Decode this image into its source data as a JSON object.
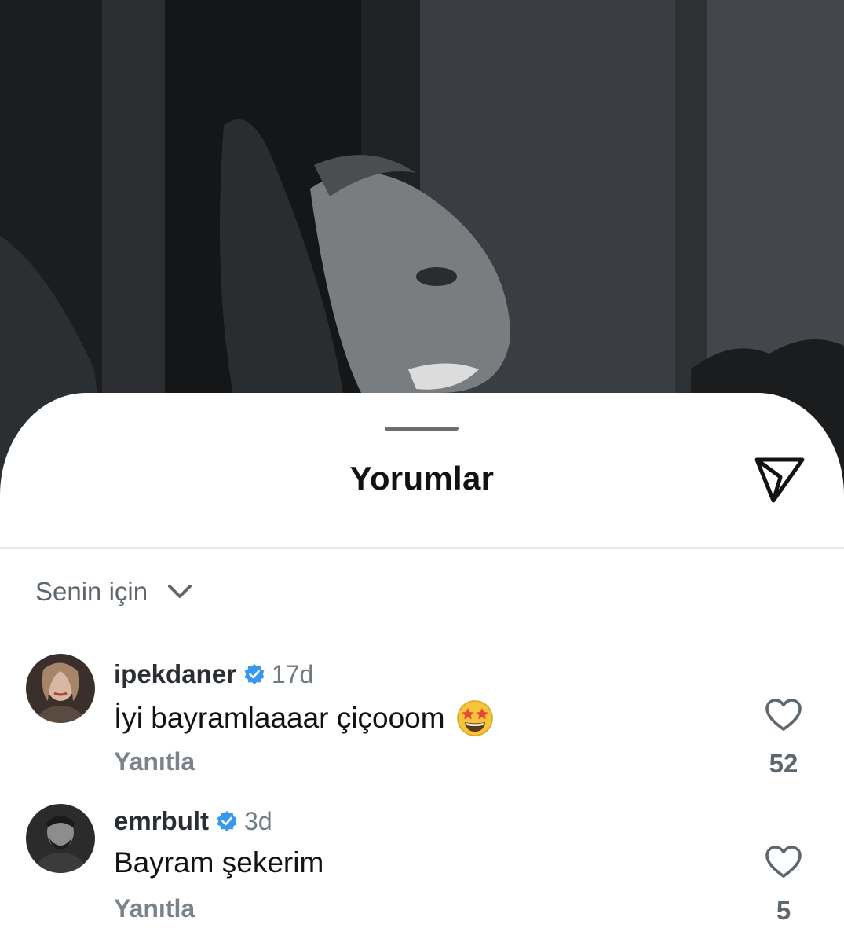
{
  "sheet": {
    "title": "Yorumlar",
    "share_icon": "send-paper-plane-icon",
    "sort_label": "Senin için",
    "sort_icon": "chevron-down-icon"
  },
  "comments": [
    {
      "username": "ipekdaner",
      "verified": true,
      "time": "17d",
      "text": "İyi bayramlaaaar çiçooom",
      "emoji": "star-struck-emoji",
      "reply_label": "Yanıtla",
      "likes": "52"
    },
    {
      "username": "emrbult",
      "verified": true,
      "time": "3d",
      "text": "Bayram şekerim",
      "reply_label": "Yanıtla",
      "likes": "5"
    }
  ],
  "colors": {
    "verified_badge": "#3897f0",
    "title_text": "#121212",
    "secondary_text": "#717a82"
  }
}
